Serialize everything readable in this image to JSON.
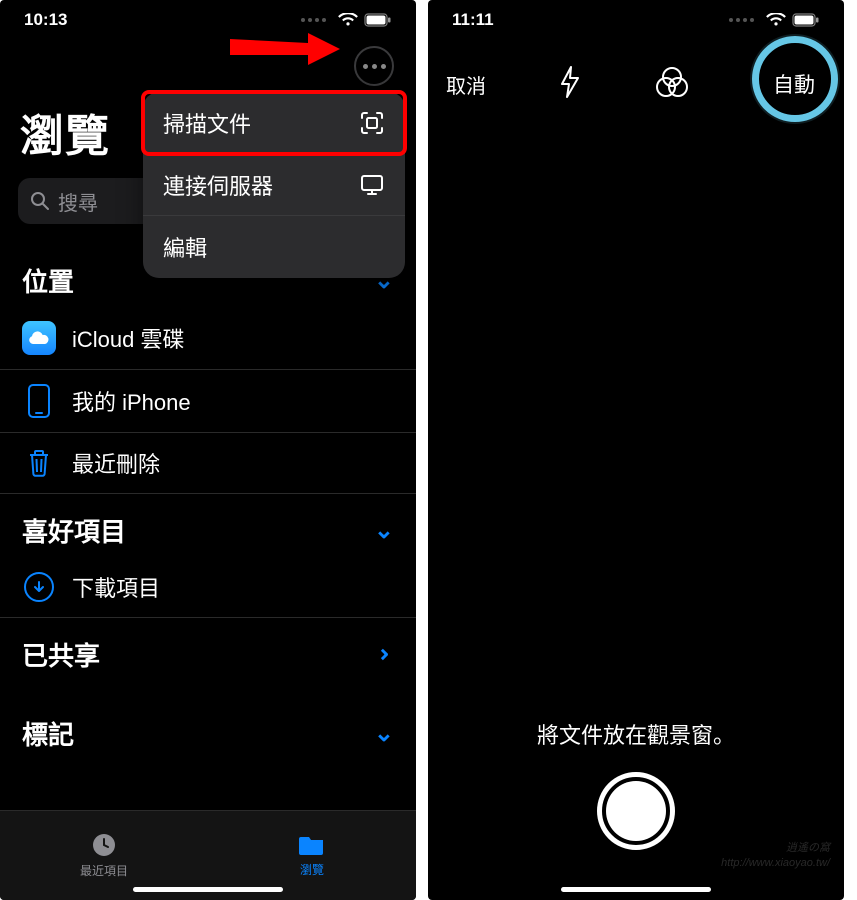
{
  "left": {
    "status_time": "10:13",
    "title": "瀏覽",
    "search_placeholder": "搜尋",
    "menu": {
      "scan": "掃描文件",
      "connect": "連接伺服器",
      "edit": "編輯"
    },
    "sections": {
      "locations": "位置",
      "favorites": "喜好項目",
      "shared": "已共享",
      "tags": "標記"
    },
    "rows": {
      "icloud": "iCloud 雲碟",
      "iphone": "我的 iPhone",
      "deleted": "最近刪除",
      "downloads": "下載項目"
    },
    "tabs": {
      "recent": "最近項目",
      "browse": "瀏覽"
    }
  },
  "right": {
    "status_time": "11:11",
    "cancel": "取消",
    "auto": "自動",
    "hint": "將文件放在觀景窗。"
  },
  "watermark": {
    "l1": "逍遙の窩",
    "l2": "http://www.xiaoyao.tw/"
  }
}
